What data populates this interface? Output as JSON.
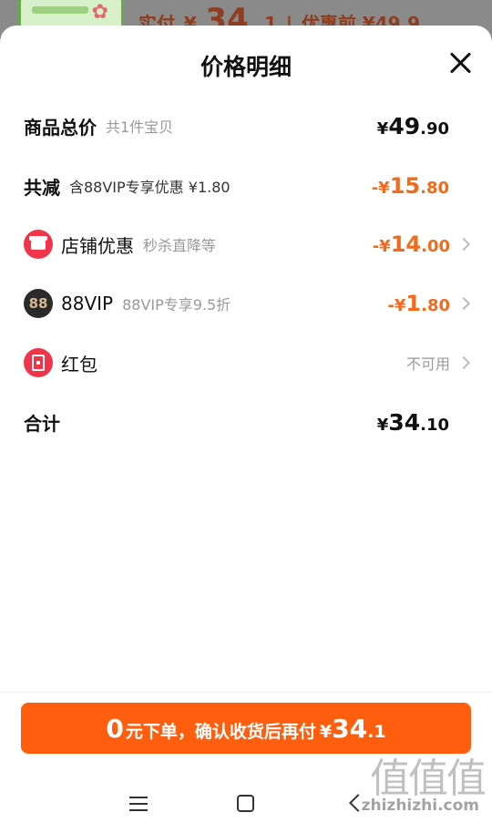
{
  "background": {
    "price_prefix": "实付",
    "price_currency": "¥",
    "price_int": "34",
    "price_dec": ".1",
    "separator": "|",
    "original_label": "优惠前 ¥49.9"
  },
  "sheet": {
    "title": "价格明细",
    "rows": [
      {
        "label": "商品总价",
        "sub": "共1件宝贝",
        "currency": "¥",
        "int": "49",
        "dec": ".90"
      },
      {
        "label": "共减",
        "sub": "含88VIP专享优惠 ¥1.80",
        "currency": "-¥",
        "int": "15",
        "dec": ".80"
      },
      {
        "label": "店铺优惠",
        "sub": "秒杀直降等",
        "currency": "-¥",
        "int": "14",
        "dec": ".00",
        "icon": "shop-icon"
      },
      {
        "label": "88VIP",
        "sub": "88VIP专享9.5折",
        "currency": "-¥",
        "int": "1",
        "dec": ".80",
        "icon": "vip-88-icon",
        "icon_text": "88"
      },
      {
        "label": "红包",
        "status": "不可用",
        "icon": "red-packet-icon"
      },
      {
        "label": "合计",
        "currency": "¥",
        "int": "34",
        "dec": ".10"
      }
    ]
  },
  "cta": {
    "prefix_num": "0",
    "text": "元下单，确认收货后再付",
    "currency": "¥",
    "int": "34",
    "dec": ".1"
  },
  "watermark": {
    "glyphs": "值值值",
    "text": "zhizhizhi.com"
  },
  "colors": {
    "accent": "#ff5e0e",
    "discount": "#f26a1b",
    "icon_red": "#f0354a",
    "vip_dark": "#2a2a2a"
  }
}
